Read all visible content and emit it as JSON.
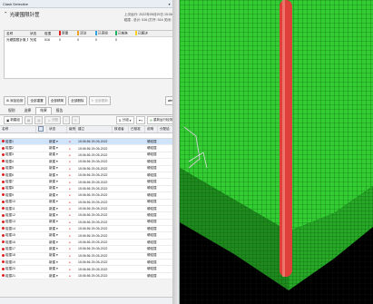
{
  "window": {
    "title": "Clash Detective",
    "controls": [
      "▾",
      "✕"
    ]
  },
  "section": {
    "title": "光硬围限针筐",
    "meta_line1": "上次运行: 2022年05月29日 15:06:5",
    "meta_line2": "碰撞 - 总计: 516 (打开: 516 关闭: 0)"
  },
  "summary": {
    "headers": [
      "名称",
      "状态",
      "碰撞",
      "新建",
      "活动",
      "已审阅",
      "已核准",
      "已解决"
    ],
    "header_colors": [
      "",
      "",
      "",
      "#e02020",
      "#f0a020",
      "#30a0e0",
      "#20b060",
      "#f5d020"
    ],
    "row": [
      "光硬围限针筐 风成",
      "完成",
      "516",
      "0",
      "0",
      "0",
      "0",
      ""
    ]
  },
  "buttons": [
    {
      "label": "添加检测"
    },
    {
      "label": "全部重置"
    },
    {
      "label": "全部精简"
    },
    {
      "label": "全部删除"
    },
    {
      "label": "全部更新"
    }
  ],
  "tabs": [
    "规则",
    "选择",
    "结果",
    "报告"
  ],
  "active_tab": "结果",
  "toolbar": {
    "new_group": "新建组",
    "assign": "分配",
    "unassign": "",
    "group_by": "分组",
    "reexport": "重新运行检测"
  },
  "grid": {
    "headers": [
      "名称",
      "",
      "状态",
      "级别",
      "建立",
      "核准者",
      "已核准",
      "说明",
      "分配给"
    ],
    "rows": [
      {
        "name": "碰撞1",
        "status": "新建",
        "created": "15:06:56 29-05-2022",
        "assign": "硬碰撞"
      },
      {
        "name": "碰撞2",
        "status": "新建",
        "created": "15:06:56 29-05-2022",
        "assign": "硬碰撞"
      },
      {
        "name": "碰撞3",
        "status": "新建",
        "created": "15:06:56 29-05-2022",
        "assign": "硬碰撞"
      },
      {
        "name": "碰撞4",
        "status": "新建",
        "created": "15:06:56 29-05-2022",
        "assign": "硬碰撞"
      },
      {
        "name": "碰撞5",
        "status": "新建",
        "created": "15:06:56 29-05-2022",
        "assign": "硬碰撞"
      },
      {
        "name": "碰撞6",
        "status": "新建",
        "created": "15:06:56 29-05-2022",
        "assign": "硬碰撞"
      },
      {
        "name": "碰撞7",
        "status": "新建",
        "created": "15:06:56 29-05-2022",
        "assign": "硬碰撞"
      },
      {
        "name": "碰撞8",
        "status": "新建",
        "created": "15:06:56 29-05-2022",
        "assign": "硬碰撞"
      },
      {
        "name": "碰撞9",
        "status": "新建",
        "created": "15:06:56 29-05-2022",
        "assign": "硬碰撞"
      },
      {
        "name": "碰撞10",
        "status": "新建",
        "created": "15:06:56 29-05-2022",
        "assign": "硬碰撞"
      },
      {
        "name": "碰撞11",
        "status": "新建",
        "created": "15:06:56 29-05-2022",
        "assign": "硬碰撞"
      },
      {
        "name": "碰撞12",
        "status": "新建",
        "created": "15:06:56 29-05-2022",
        "assign": "硬碰撞"
      },
      {
        "name": "碰撞13",
        "status": "新建",
        "created": "15:06:56 29-05-2022",
        "assign": "硬碰撞"
      },
      {
        "name": "碰撞14",
        "status": "新建",
        "created": "15:06:56 29-05-2022",
        "assign": "硬碰撞"
      },
      {
        "name": "碰撞15",
        "status": "新建",
        "created": "15:06:56 29-05-2022",
        "assign": "硬碰撞"
      },
      {
        "name": "碰撞16",
        "status": "新建",
        "created": "15:06:56 29-05-2022",
        "assign": "硬碰撞"
      },
      {
        "name": "碰撞17",
        "status": "新建",
        "created": "15:06:56 29-05-2022",
        "assign": "硬碰撞"
      },
      {
        "name": "碰撞18",
        "status": "新建",
        "created": "15:06:56 29-05-2022",
        "assign": "硬碰撞"
      },
      {
        "name": "碰撞19",
        "status": "新建",
        "created": "15:06:56 29-05-2022",
        "assign": "硬碰撞"
      },
      {
        "name": "碰撞20",
        "status": "新建",
        "created": "15:06:56 29-05-2022",
        "assign": "硬碰撞"
      },
      {
        "name": "碰撞21",
        "status": "新建",
        "created": "15:06:56 29-05-2022",
        "assign": "硬碰撞"
      }
    ]
  },
  "colors": {
    "new_status": "#e02020",
    "mesh": "#2ecc2e",
    "pipe": "#e0403a"
  }
}
